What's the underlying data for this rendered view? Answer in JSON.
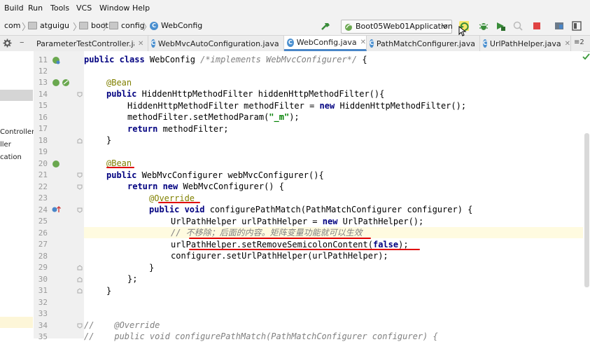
{
  "menu": [
    "Build",
    "Run",
    "Tools",
    "VCS",
    "Window",
    "Help"
  ],
  "breadcrumb": {
    "items": [
      "com",
      "atguigu",
      "boot",
      "config",
      "WebConfig"
    ]
  },
  "run_config": {
    "label": "Boot05Web01Application"
  },
  "tabs": [
    {
      "label": "ParameterTestController.java"
    },
    {
      "label": "WebMvcAutoConfiguration.java"
    },
    {
      "label": "WebConfig.java"
    },
    {
      "label": "PathMatchConfigurer.java"
    },
    {
      "label": "UrlPathHelper.java"
    }
  ],
  "tab_overflow": "≡2",
  "project_panel": {
    "items": [
      "Controller",
      "ller",
      "cation"
    ]
  },
  "line_numbers": [
    "11",
    "12",
    "13",
    "14",
    "15",
    "16",
    "17",
    "18",
    "19",
    "20",
    "21",
    "22",
    "23",
    "24",
    "25",
    "26",
    "27",
    "28",
    "29",
    "30",
    "31",
    "32",
    "33",
    "34",
    "35"
  ],
  "code": {
    "l11": {
      "k1": "public class ",
      "t": "WebConfig ",
      "c": "/*implements WebMvcConfigurer*/ ",
      "e": "{"
    },
    "l13": {
      "a": "@Bean"
    },
    "l14": {
      "k": "public ",
      "t": "HiddenHttpMethodFilter hiddenHttpMethodFilter(){"
    },
    "l15": {
      "t1": "HiddenHttpMethodFilter methodFilter = ",
      "k": "new ",
      "t2": "HiddenHttpMethodFilter();"
    },
    "l16": {
      "t1": "methodFilter.setMethodParam(",
      "s": "\"_m\"",
      "t2": ");"
    },
    "l17": {
      "k": "return ",
      "t": "methodFilter;"
    },
    "l18": {
      "t": "}"
    },
    "l20": {
      "a": "@Bean"
    },
    "l21": {
      "k": "public ",
      "t": "WebMvcConfigurer webMvcConfigurer(){"
    },
    "l22": {
      "k": "return new ",
      "t": "WebMvcConfigurer() {"
    },
    "l23": {
      "a": "@Override"
    },
    "l24": {
      "k": "public void ",
      "t": "configurePathMatch(PathMatchConfigurer configurer) {"
    },
    "l25": {
      "t1": "UrlPathHelper urlPathHelper = ",
      "k": "new ",
      "t2": "UrlPathHelper();"
    },
    "l26": {
      "c": "// 不移除；后面的内容。矩阵变量功能就可以生效"
    },
    "l27": {
      "t1": "urlPathHelper.setRemoveSemicolonContent(",
      "k": "false",
      "t2": ");"
    },
    "l28": {
      "t": "configurer.setUrlPathHelper(urlPathHelper);"
    },
    "l29": {
      "t": "}"
    },
    "l30": {
      "t": "};"
    },
    "l31": {
      "t": "}"
    },
    "l34": {
      "c": "//    @Override"
    },
    "l35": {
      "c": "//    public void configurePathMatch(PathMatchConfigurer configurer) {"
    }
  }
}
